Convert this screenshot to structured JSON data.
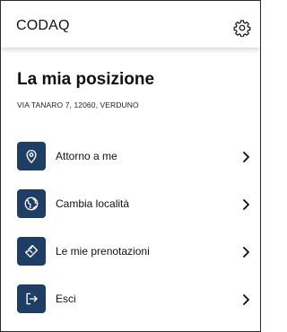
{
  "header": {
    "app_name": "CODAQ",
    "settings_icon": "gear-icon"
  },
  "page": {
    "title": "La mia posizione",
    "address": "VIA TANARO 7, 12060, VERDUNO"
  },
  "menu": {
    "items": [
      {
        "label": "Attorno a me",
        "icon": "location-pin-icon"
      },
      {
        "label": "Cambia località",
        "icon": "globe-icon"
      },
      {
        "label": "Le mie prenotazioni",
        "icon": "ticket-icon"
      },
      {
        "label": "Esci",
        "icon": "logout-icon"
      }
    ]
  },
  "colors": {
    "icon_background": "#1f3e66",
    "text": "#111111"
  }
}
